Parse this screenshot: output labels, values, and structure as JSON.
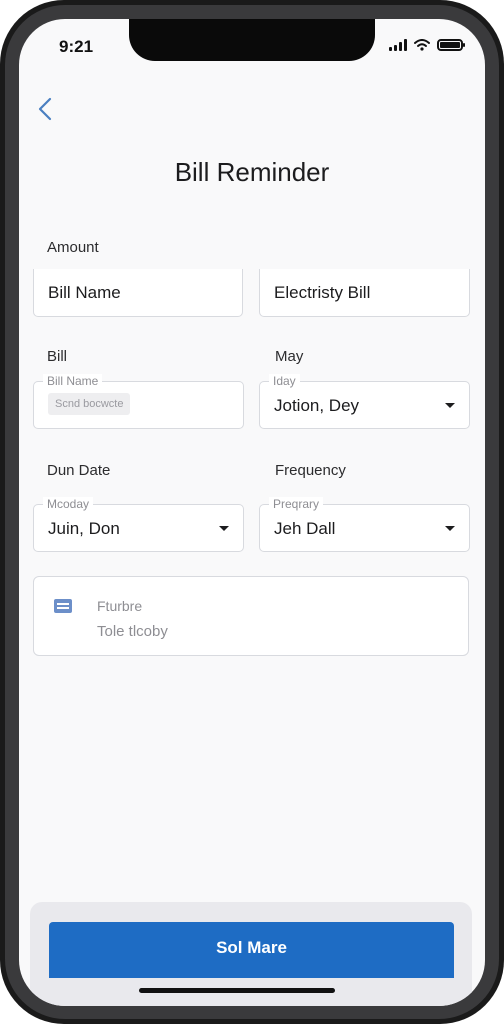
{
  "status_bar": {
    "time": "9:21"
  },
  "page": {
    "title": "Bill Reminder"
  },
  "form": {
    "amount": {
      "label": "Amount",
      "bill_name_value": "Bill Name",
      "electricity_value": "Electristy Bill"
    },
    "bill": {
      "label": "Bill",
      "float_label": "Bill Name",
      "chip_text": "Scnd bocwcte"
    },
    "may": {
      "label": "May",
      "float_label": "Iday",
      "value": "Jotion, Dey"
    },
    "due_date": {
      "label": "Dun Date",
      "float_label": "Mcoday",
      "value": "Juin, Don"
    },
    "frequency": {
      "label": "Frequency",
      "float_label": "Preqrary",
      "value": "Jeh Dall"
    }
  },
  "note_card": {
    "title": "Fturbre",
    "subtitle": "Tole tlcoby",
    "icon": "card-icon"
  },
  "footer": {
    "button_label": "Sol Mare"
  },
  "colors": {
    "accent": "#1e6cc4",
    "back_icon": "#4a7fc1",
    "note_icon": "#6c8fc9"
  }
}
